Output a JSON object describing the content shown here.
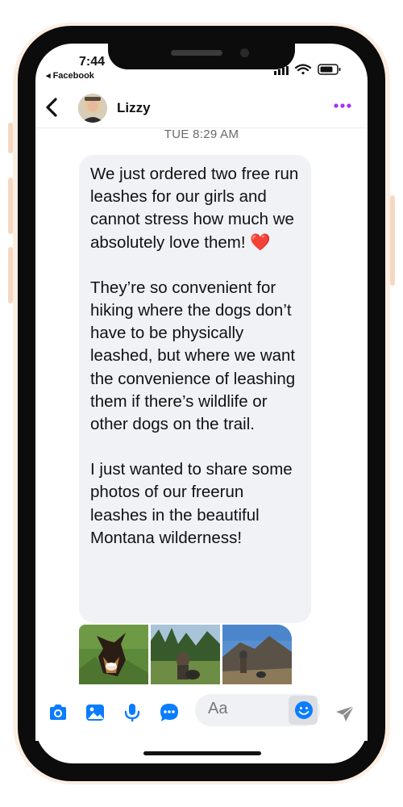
{
  "status_bar": {
    "time": "7:44",
    "back_app": "◂ Facebook"
  },
  "header": {
    "contact_name": "Lizzy",
    "more_icon": "more-dots-icon",
    "back_icon": "chevron-left-icon"
  },
  "conversation": {
    "timestamp": "TUE 8:29 AM",
    "message": {
      "paragraph_1": "We just ordered two free run leashes for our girls and cannot stress how much we absolutely love them! ❤️",
      "paragraph_2": "They’re so convenient for hiking where the dogs don’t have to be physically leashed, but where we want the convenience of leashing them if there’s wildlife or other dogs on the trail.",
      "paragraph_3": "I just wanted to share some photos of our freerun leashes in the beautiful Montana wilderness!"
    },
    "photos": [
      "dog-photo",
      "hiker-dog-forest-photo",
      "hiker-mountain-photo"
    ]
  },
  "composer": {
    "placeholder": "Aa",
    "icons": [
      "camera-icon",
      "gallery-icon",
      "microphone-icon",
      "chat-bubble-icon",
      "emoji-icon",
      "send-icon"
    ]
  },
  "colors": {
    "accent": "#0a7cff",
    "more_dots": "#a033ff",
    "bubble": "#f1f2f6",
    "heart": "#e0245e"
  }
}
